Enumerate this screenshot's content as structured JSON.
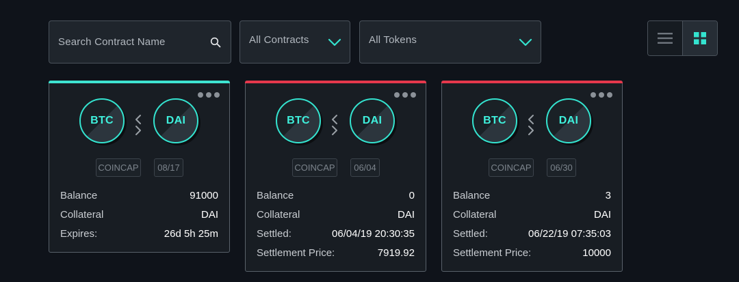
{
  "search": {
    "placeholder": "Search Contract Name",
    "icon": "search-icon"
  },
  "filters": {
    "contracts": {
      "selected": "All Contracts"
    },
    "tokens": {
      "selected": "All Tokens"
    }
  },
  "view_toggle": {
    "active": "grid",
    "options": [
      "list",
      "grid"
    ]
  },
  "colors": {
    "background": "#0f131a",
    "accent_teal": "#34e3cf",
    "status_active": "#3ee3d0",
    "status_settled": "#e5384c"
  },
  "cards": [
    {
      "status_color": "#3ee3d0",
      "token_a": "BTC",
      "token_b": "DAI",
      "source": "COINCAP",
      "date": "08/17",
      "rows": [
        {
          "label": "Balance",
          "value": "91000"
        },
        {
          "label": "Collateral",
          "value": "DAI"
        },
        {
          "label": "Expires:",
          "value": "26d 5h 25m"
        }
      ]
    },
    {
      "status_color": "#e5384c",
      "token_a": "BTC",
      "token_b": "DAI",
      "source": "COINCAP",
      "date": "06/04",
      "rows": [
        {
          "label": "Balance",
          "value": "0"
        },
        {
          "label": "Collateral",
          "value": "DAI"
        },
        {
          "label": "Settled:",
          "value": "06/04/19 20:30:35"
        },
        {
          "label": "Settlement Price:",
          "value": "7919.92"
        }
      ]
    },
    {
      "status_color": "#e5384c",
      "token_a": "BTC",
      "token_b": "DAI",
      "source": "COINCAP",
      "date": "06/30",
      "rows": [
        {
          "label": "Balance",
          "value": "3"
        },
        {
          "label": "Collateral",
          "value": "DAI"
        },
        {
          "label": "Settled:",
          "value": "06/22/19 07:35:03"
        },
        {
          "label": "Settlement Price:",
          "value": "10000"
        }
      ]
    }
  ]
}
